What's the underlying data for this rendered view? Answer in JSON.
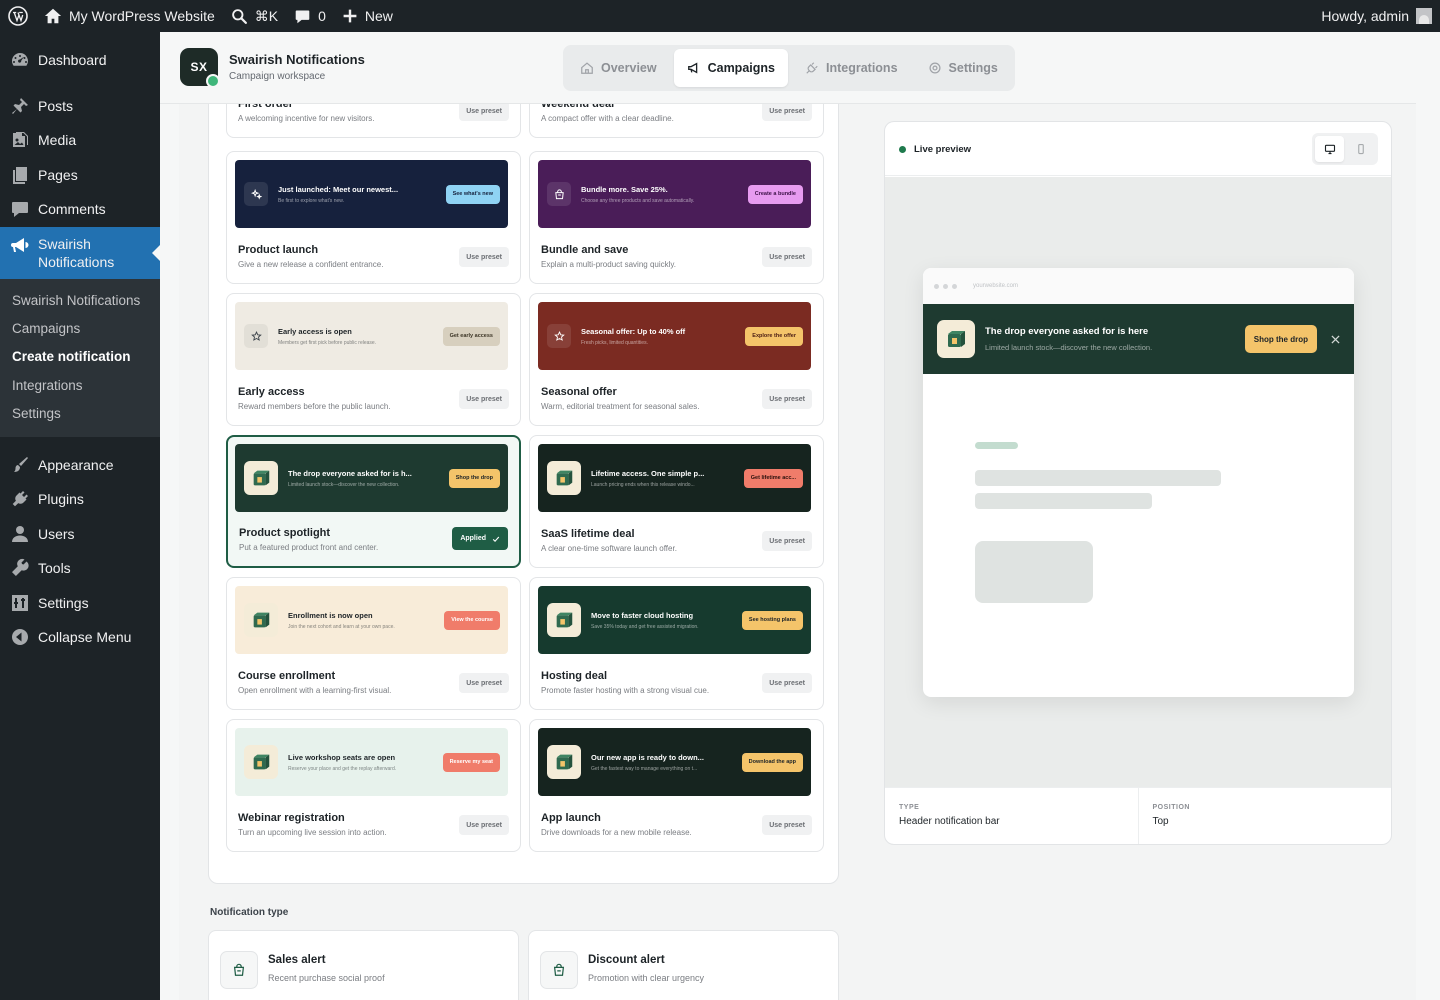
{
  "adminbar": {
    "site_name": "My WordPress Website",
    "search_shortcut": "⌘K",
    "comments_count": "0",
    "new_label": "New",
    "howdy": "Howdy, admin"
  },
  "menu": {
    "dashboard": "Dashboard",
    "posts": "Posts",
    "media": "Media",
    "pages": "Pages",
    "comments": "Comments",
    "swairish": "Swairish Notifications",
    "appearance": "Appearance",
    "plugins": "Plugins",
    "users": "Users",
    "tools": "Tools",
    "settings": "Settings",
    "collapse": "Collapse Menu",
    "submenu": [
      "Swairish Notifications",
      "Campaigns",
      "Create notification",
      "Integrations",
      "Settings"
    ]
  },
  "app": {
    "logo_text": "SX",
    "title": "Swairish Notifications",
    "subtitle": "Campaign workspace",
    "tabs": [
      "Overview",
      "Campaigns",
      "Integrations",
      "Settings"
    ]
  },
  "presets": [
    {
      "title": "First order",
      "desc": "A welcoming incentive for new visitors.",
      "button": "Use preset"
    },
    {
      "title": "Weekend deal",
      "desc": "A compact offer with a clear deadline.",
      "button": "Use preset"
    },
    {
      "title": "Product launch",
      "desc": "Give a new release a confident entrance.",
      "button": "Use preset",
      "headline": "Just launched: Meet our newest...",
      "sub": "Be first to explore what's new.",
      "cta": "See what's new",
      "bg": "#16213d",
      "fg": "#ffffff",
      "cta_bg": "#8fd3f4",
      "cta_fg": "#16213d"
    },
    {
      "title": "Bundle and save",
      "desc": "Explain a multi-product saving quickly.",
      "button": "Use preset",
      "headline": "Bundle more. Save 25%.",
      "sub": "Choose any three products and save automatically.",
      "cta": "Create a bundle",
      "bg": "#4a1d58",
      "fg": "#ffffff",
      "cta_bg": "#e79bf0",
      "cta_fg": "#3b1046"
    },
    {
      "title": "Early access",
      "desc": "Reward members before the public launch.",
      "button": "Use preset",
      "headline": "Early access is open",
      "sub": "Members get first pick before public release.",
      "cta": "Get early access",
      "bg": "#efebe3",
      "fg": "#1d2327",
      "cta_bg": "#d7cfbe",
      "cta_fg": "#3c3526"
    },
    {
      "title": "Seasonal offer",
      "desc": "Warm, editorial treatment for seasonal sales.",
      "button": "Use preset",
      "headline": "Seasonal offer: Up to 40% off",
      "sub": "Fresh picks, limited quantities.",
      "cta": "Explore the offer",
      "bg": "#7b2b22",
      "fg": "#ffffff",
      "cta_bg": "#f4c46a",
      "cta_fg": "#4a1c14"
    },
    {
      "title": "Product spotlight",
      "desc": "Put a featured product front and center.",
      "button": "Applied",
      "headline": "The drop everyone asked for is h...",
      "sub": "Limited launch stock—discover the new collection.",
      "cta": "Shop the drop",
      "bg": "#1e3a30",
      "fg": "#ffffff",
      "cta_bg": "#f4c46a",
      "cta_fg": "#1d2327"
    },
    {
      "title": "SaaS lifetime deal",
      "desc": "A clear one-time software launch offer.",
      "button": "Use preset",
      "headline": "Lifetime access. One simple p...",
      "sub": "Launch pricing ends when this release windo...",
      "cta": "Get lifetime acc...",
      "bg": "#16241f",
      "fg": "#ffffff",
      "cta_bg": "#f07c6a",
      "cta_fg": "#2a100c"
    },
    {
      "title": "Course enrollment",
      "desc": "Open enrollment with a learning-first visual.",
      "button": "Use preset",
      "headline": "Enrollment is now open",
      "sub": "Join the next cohort and learn at your own pace.",
      "cta": "View the course",
      "bg": "#f8ecd9",
      "fg": "#1d2327",
      "cta_bg": "#f07c6a",
      "cta_fg": "#ffffff"
    },
    {
      "title": "Hosting deal",
      "desc": "Promote faster hosting with a strong visual cue.",
      "button": "Use preset",
      "headline": "Move to faster cloud hosting",
      "sub": "Save 35% today and get free assisted migration.",
      "cta": "See hosting plans",
      "bg": "#163a2e",
      "fg": "#ffffff",
      "cta_bg": "#f4c46a",
      "cta_fg": "#1d2327"
    },
    {
      "title": "Webinar registration",
      "desc": "Turn an upcoming live session into action.",
      "button": "Use preset",
      "headline": "Live workshop seats are open",
      "sub": "Reserve your place and get the replay afterward.",
      "cta": "Reserve my seat",
      "bg": "#e7f2ec",
      "fg": "#1d2327",
      "cta_bg": "#f07c6a",
      "cta_fg": "#ffffff"
    },
    {
      "title": "App launch",
      "desc": "Drive downloads for a new mobile release.",
      "button": "Use preset",
      "headline": "Our new app is ready to down...",
      "sub": "Get the fastest way to manage everything on t...",
      "cta": "Download the app",
      "bg": "#16241f",
      "fg": "#ffffff",
      "cta_bg": "#f4c46a",
      "cta_fg": "#1d2327"
    }
  ],
  "notification_type": {
    "label": "Notification type",
    "types": [
      {
        "title": "Sales alert",
        "desc": "Recent purchase social proof"
      },
      {
        "title": "Discount alert",
        "desc": "Promotion with clear urgency"
      }
    ]
  },
  "preview": {
    "label": "Live preview",
    "url": "yourwebsite.com",
    "headline": "The drop everyone asked for is here",
    "sub": "Limited launch stock—discover the new collection.",
    "cta": "Shop the drop",
    "type_label": "TYPE",
    "type_value": "Header notification bar",
    "position_label": "POSITION",
    "position_value": "Top"
  },
  "colors": {
    "wp_dark": "#1d2327",
    "wp_blue": "#2271b1",
    "accent_green": "#1f5d45",
    "live_dot": "#1f7a4d"
  }
}
